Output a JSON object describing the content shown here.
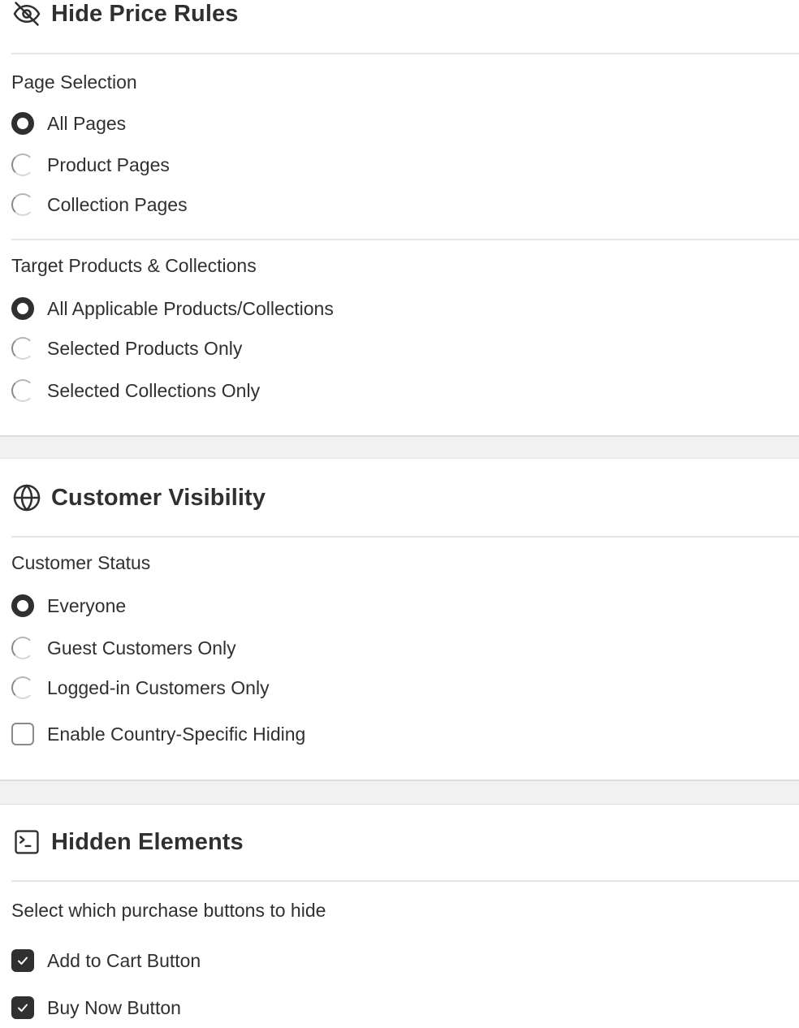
{
  "hide_price_rules": {
    "title": "Hide Price Rules",
    "icon": "eye-slash-icon",
    "page_selection": {
      "label": "Page Selection",
      "options": [
        {
          "label": "All Pages",
          "selected": true
        },
        {
          "label": "Product Pages",
          "selected": false
        },
        {
          "label": "Collection Pages",
          "selected": false
        }
      ]
    },
    "target": {
      "label": "Target Products & Collections",
      "options": [
        {
          "label": "All Applicable Products/Collections",
          "selected": true
        },
        {
          "label": "Selected Products Only",
          "selected": false
        },
        {
          "label": "Selected Collections Only",
          "selected": false
        }
      ]
    }
  },
  "customer_visibility": {
    "title": "Customer Visibility",
    "icon": "globe-icon",
    "customer_status": {
      "label": "Customer Status",
      "options": [
        {
          "label": "Everyone",
          "selected": true
        },
        {
          "label": "Guest Customers Only",
          "selected": false
        },
        {
          "label": "Logged-in Customers Only",
          "selected": false
        }
      ]
    },
    "country_hiding": {
      "label": "Enable Country-Specific Hiding",
      "checked": false
    }
  },
  "hidden_elements": {
    "title": "Hidden Elements",
    "icon": "terminal-icon",
    "description": "Select which purchase buttons to hide",
    "options": [
      {
        "label": "Add to Cart Button",
        "checked": true
      },
      {
        "label": "Buy Now Button",
        "checked": true
      }
    ]
  }
}
